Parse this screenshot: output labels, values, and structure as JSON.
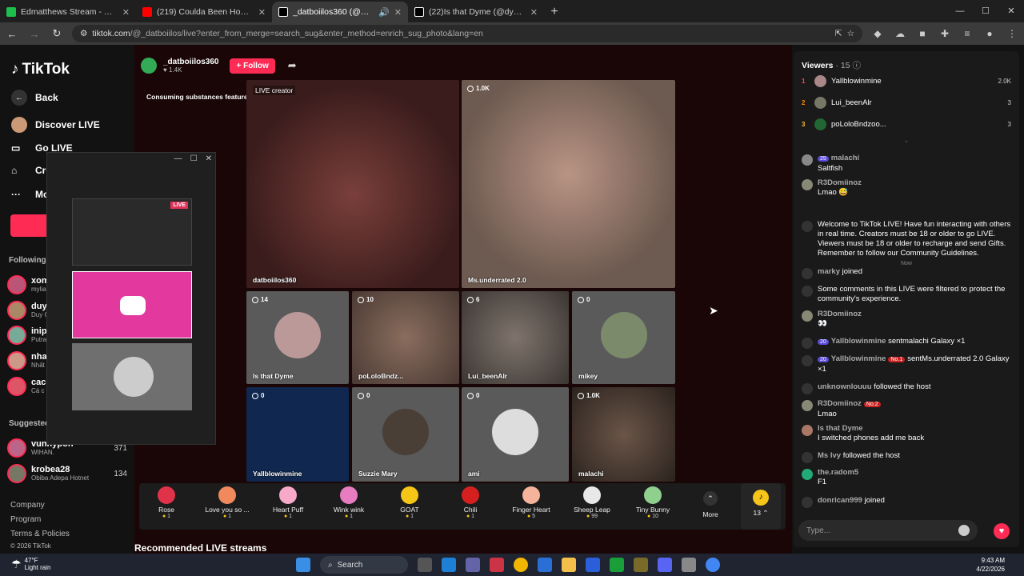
{
  "tabs": [
    {
      "title": "Edmatthews Stream - Watch Live",
      "color": "#1fbf4b"
    },
    {
      "title": "(219) Coulda Been House 2, Ep",
      "color": "#ff0000"
    },
    {
      "title": "_datboiilos360 (@_datboiilos",
      "color": "#000000"
    },
    {
      "title": "(22)Is that Dyme (@dymestayp",
      "color": "#000000"
    }
  ],
  "url": {
    "host": "tiktok.com",
    "path": "/@_datboiilos/live?enter_from_merge=search_sug&enter_method=enrich_sug_photo&lang=en"
  },
  "left": {
    "logo": "TikTok",
    "back": "Back",
    "discover": "Discover LIVE",
    "golive": "Go LIVE",
    "create": "Cre",
    "more": "Mo",
    "following": "Following",
    "suggested": "Suggested",
    "follows": [
      {
        "name": "xom",
        "sub": "mylia"
      },
      {
        "name": "duy",
        "sub": "Duy C"
      },
      {
        "name": "inip",
        "sub": "Putra"
      },
      {
        "name": "nha",
        "sub": "Nhất"
      },
      {
        "name": "cac",
        "sub": "Cá c"
      }
    ],
    "suggest": [
      {
        "name": "vunnypon",
        "sub": "WIHAN.",
        "count": "371"
      },
      {
        "name": "krobea28",
        "sub": "Obiba Adepa Hotnet",
        "count": "134"
      }
    ],
    "footer": [
      "Company",
      "Program",
      "Terms & Policies",
      "© 2026 TikTok"
    ]
  },
  "pip": {
    "live_badge": "LIVE"
  },
  "host": {
    "name": "_datboiilos360",
    "likes": "1.4K",
    "follow": "+ Follow"
  },
  "warning": "Consuming substances featured in this LIVE could ha...",
  "tiles": [
    {
      "name": "datboiilos360",
      "badge": "LIVE creator"
    },
    {
      "name": "Ms.underrated 2.0",
      "count": "1.0K"
    },
    {
      "name": "Is that Dyme",
      "count": "14"
    },
    {
      "name": "poLoloBndz...",
      "count": "10"
    },
    {
      "name": "Lui_beenAlr",
      "count": "6"
    },
    {
      "name": "mikey",
      "count": "0"
    },
    {
      "name": "Yallblowinmine",
      "count": "0"
    },
    {
      "name": "Suzzie Mary",
      "count": "0"
    },
    {
      "name": "ami",
      "count": "0"
    },
    {
      "name": "malachi",
      "count": "1.0K"
    }
  ],
  "gifts": [
    {
      "name": "Rose",
      "cost": "1",
      "color": "#e0334a"
    },
    {
      "name": "Love you so ...",
      "cost": "1",
      "color": "#f08a5d"
    },
    {
      "name": "Heart Puff",
      "cost": "1",
      "color": "#f7a9c9"
    },
    {
      "name": "Wink wink",
      "cost": "1",
      "color": "#e87cc0"
    },
    {
      "name": "GOAT",
      "cost": "1",
      "color": "#f5c518"
    },
    {
      "name": "Chili",
      "cost": "1",
      "color": "#d62020"
    },
    {
      "name": "Finger Heart",
      "cost": "5",
      "color": "#f4b39a"
    },
    {
      "name": "Sheep Leap",
      "cost": "99",
      "color": "#e8e8e8"
    },
    {
      "name": "Tiny Bunny",
      "cost": "10",
      "color": "#8fd08f"
    }
  ],
  "more": "More",
  "coins": "13",
  "recommended": "Recommended LIVE streams",
  "viewers": {
    "title": "Viewers",
    "count": "· 15",
    "list": [
      {
        "rank": "1",
        "name": "Yallblowinmine",
        "num": "2.0K"
      },
      {
        "rank": "2",
        "name": "Lui_beenAlr",
        "num": "3"
      },
      {
        "rank": "3",
        "name": "poLoloBndzoo...",
        "num": "3"
      }
    ]
  },
  "chat": [
    {
      "user": "malachi",
      "lvl": "25",
      "text": "Saltfish"
    },
    {
      "user": "R3Domiinoz",
      "text": "Lmao 😅"
    },
    {
      "text": "Welcome to TikTok LIVE! Have fun interacting with others in real time. Creators must be 18 or older to go LIVE. Viewers must be 18 or older to recharge and send Gifts. Remember to follow our Community Guidelines."
    },
    {
      "user": "marky",
      "text": "joined"
    },
    {
      "text": "Some comments in this LIVE were filtered to protect the community's experience."
    },
    {
      "user": "R3Domiinoz",
      "text": "👀"
    },
    {
      "lvl": "20",
      "user": "Yallblowinmine",
      "text": "sentmalachi  Galaxy  ×1"
    },
    {
      "lvl": "20",
      "user": "Yallblowinmine",
      "badge": "No.1",
      "text": "sentMs.underrated 2.0 Galaxy  ×1"
    },
    {
      "user": "unknownlouuu",
      "text": "followed the host"
    },
    {
      "user": "R3Domiinoz",
      "badge": "No.2",
      "text": "Lmao"
    },
    {
      "user": "Is that Dyme",
      "text": "I switched phones add me back"
    },
    {
      "user": "Ms Ivy",
      "text": "followed the host"
    },
    {
      "user": "the.radom5",
      "text": "F1"
    },
    {
      "user": "donrican999",
      "text": "joined"
    }
  ],
  "now": "Now",
  "input_placeholder": "Type...",
  "taskbar": {
    "temp": "47°F",
    "weather": "Light rain",
    "search": "Search",
    "time": "9:43 AM",
    "date": "4/22/2026"
  }
}
